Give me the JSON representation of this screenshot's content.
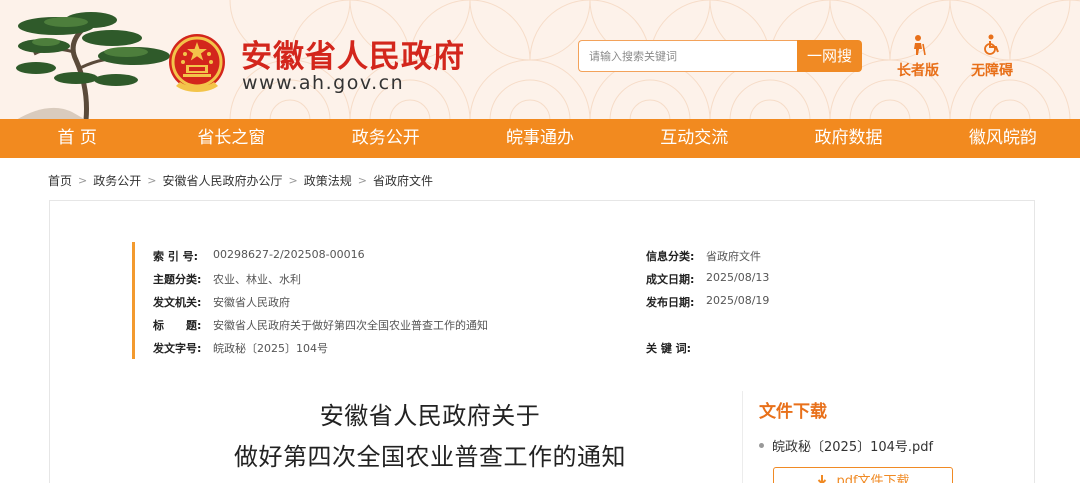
{
  "header": {
    "site_title": "安徽省人民政府",
    "site_url": "www.ah.gov.cn",
    "search_placeholder": "请输入搜索关键词",
    "search_button": "一网搜",
    "tools": [
      {
        "label": "长者版",
        "icon": "elderly-person-icon"
      },
      {
        "label": "无障碍",
        "icon": "wheelchair-icon"
      }
    ],
    "colors": {
      "brand_red": "#d3261c",
      "accent_orange": "#f28a1f"
    }
  },
  "nav": {
    "items": [
      {
        "label": "首 页"
      },
      {
        "label": "省长之窗"
      },
      {
        "label": "政务公开"
      },
      {
        "label": "皖事通办"
      },
      {
        "label": "互动交流"
      },
      {
        "label": "政府数据"
      },
      {
        "label": "徽风皖韵"
      }
    ]
  },
  "breadcrumb": [
    "首页",
    "政务公开",
    "安徽省人民政府办公厅",
    "政策法规",
    "省政府文件"
  ],
  "meta": {
    "index_label": "索 引 号:",
    "index_value": "00298627-2/202508-00016",
    "topic_label": "主题分类:",
    "topic_value": "农业、林业、水利",
    "issuer_label": "发文机关:",
    "issuer_value": "安徽省人民政府",
    "title_label": "标　　题:",
    "title_value": "安徽省人民政府关于做好第四次全国农业普查工作的通知",
    "docno_label": "发文字号:",
    "docno_value": "皖政秘〔2025〕104号",
    "category_label": "信息分类:",
    "category_value": "省政府文件",
    "created_label": "成文日期:",
    "created_value": "2025/08/13",
    "published_label": "发布日期:",
    "published_value": "2025/08/19",
    "keywords_label": "关 键 词:",
    "keywords_value": ""
  },
  "document": {
    "title_line1": "安徽省人民政府关于",
    "title_line2": "做好第四次全国农业普查工作的通知"
  },
  "download": {
    "title": "文件下载",
    "file_name": "皖政秘〔2025〕104号.pdf",
    "button_label": "pdf文件下载"
  }
}
